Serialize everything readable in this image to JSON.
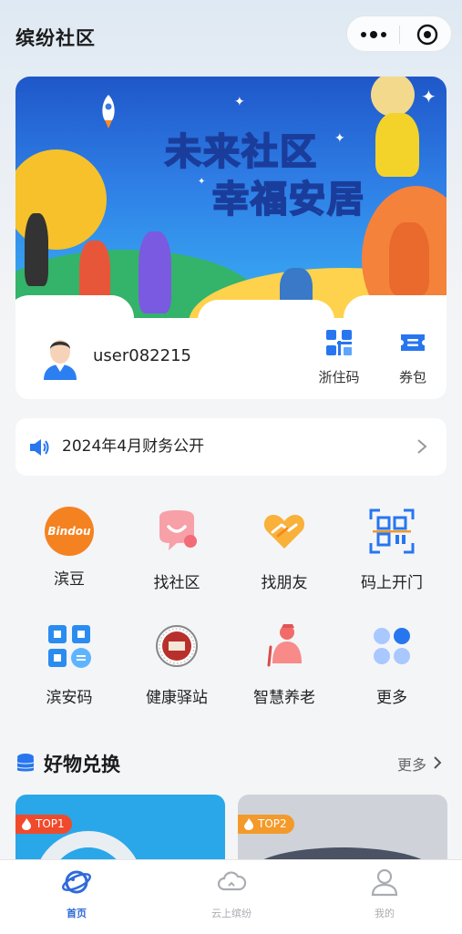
{
  "header": {
    "title": "缤纷社区"
  },
  "banner": {
    "line1": "未来社区",
    "line2": "幸福安居"
  },
  "user": {
    "name": "user082215"
  },
  "quick_actions": [
    {
      "label": "浙住码",
      "icon": "qr-grid-icon"
    },
    {
      "label": "券包",
      "icon": "ticket-icon"
    }
  ],
  "notice": {
    "text": "2024年4月财务公开",
    "icon": "speaker-icon"
  },
  "services": [
    {
      "label": "滨豆",
      "icon": "bindou-logo-icon",
      "icon_text": "Bindou"
    },
    {
      "label": "找社区",
      "icon": "chat-bubble-icon"
    },
    {
      "label": "找朋友",
      "icon": "handshake-heart-icon"
    },
    {
      "label": "码上开门",
      "icon": "qr-scan-icon"
    },
    {
      "label": "滨安码",
      "icon": "qr-code-icon"
    },
    {
      "label": "健康驿站",
      "icon": "health-seal-icon"
    },
    {
      "label": "智慧养老",
      "icon": "elderly-icon"
    },
    {
      "label": "更多",
      "icon": "four-dots-icon"
    }
  ],
  "goods_section": {
    "title": "好物兑换",
    "more_label": "更多",
    "items": [
      {
        "badge": "TOP1",
        "badge_color": "#f04a2c",
        "bg": "#2aa7e8"
      },
      {
        "badge": "TOP2",
        "badge_color": "#f39a2a",
        "bg": "#cfd3d9"
      }
    ]
  },
  "tabbar": [
    {
      "label": "首页",
      "icon": "planet-icon",
      "active": true
    },
    {
      "label": "云上缤纷",
      "icon": "cloud-icon",
      "active": false
    },
    {
      "label": "我的",
      "icon": "profile-icon",
      "active": false
    }
  ],
  "colors": {
    "accent": "#2f6bd8",
    "primary_blue": "#2776f0",
    "inactive": "#a9acb2"
  }
}
